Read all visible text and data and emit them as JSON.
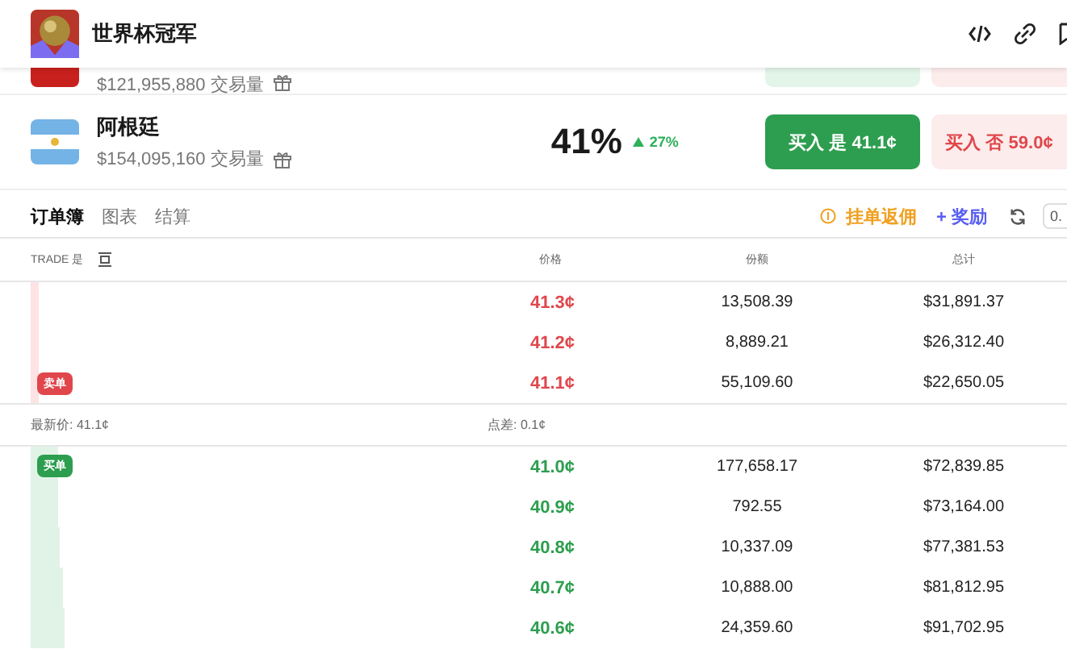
{
  "header": {
    "title": "世界杯冠军"
  },
  "markets": [
    {
      "kind": "partial",
      "volume": "$121,955,880 交易量"
    },
    {
      "kind": "full",
      "name": "阿根廷",
      "volume": "$154,095,160 交易量",
      "chance": "41%",
      "change": "27%",
      "buy_yes": "买入 是 41.1¢",
      "buy_no": "买入 否 59.0¢"
    }
  ],
  "tabs": [
    {
      "label": "订单簿",
      "selected": true
    },
    {
      "label": "图表",
      "selected": false
    },
    {
      "label": "结算",
      "selected": false
    }
  ],
  "actions": {
    "rebate": "挂单返佣",
    "reward": "+ 奖励",
    "tick": "0."
  },
  "orderbook": {
    "trade_label": "TRADE 是",
    "columns": [
      "价格",
      "份额",
      "总计"
    ],
    "asks": [
      {
        "price": "41.3¢",
        "shares": "13,508.39",
        "total": "$31,891.37",
        "level": 0.018
      },
      {
        "price": "41.2¢",
        "shares": "8,889.21",
        "total": "$26,312.40",
        "level": 0.018
      },
      {
        "price": "41.1¢",
        "shares": "55,109.60",
        "total": "$22,650.05",
        "level": 0.018
      }
    ],
    "ask_badge": "卖单",
    "last_price": "最新价: 41.1¢",
    "spread": "点差: 0.1¢",
    "bid_badge": "买单",
    "bids": [
      {
        "price": "41.0¢",
        "shares": "177,658.17",
        "total": "$72,839.85",
        "level": 0.06
      },
      {
        "price": "40.9¢",
        "shares": "792.55",
        "total": "$73,164.00",
        "level": 0.062
      },
      {
        "price": "40.8¢",
        "shares": "10,337.09",
        "total": "$77,381.53",
        "level": 0.065
      },
      {
        "price": "40.7¢",
        "shares": "10,888.00",
        "total": "$81,812.95",
        "level": 0.07
      },
      {
        "price": "40.6¢",
        "shares": "24,359.60",
        "total": "$91,702.95",
        "level": 0.075
      }
    ]
  }
}
